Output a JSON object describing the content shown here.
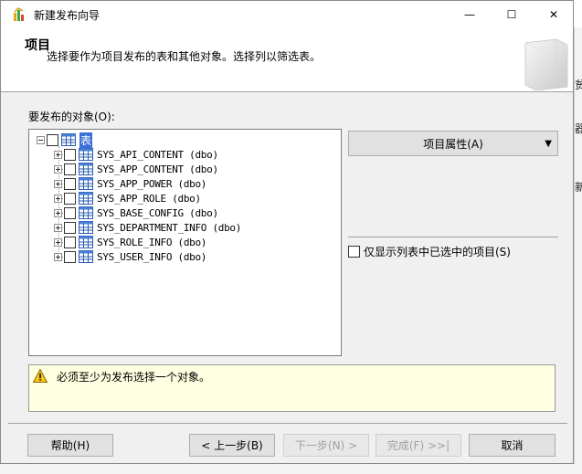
{
  "window": {
    "title": "新建发布向导",
    "minimize_glyph": "—",
    "maximize_glyph": "☐",
    "close_glyph": "✕"
  },
  "header": {
    "title": "项目",
    "subtitle": "选择要作为项目发布的表和其他对象。选择列以筛选表。"
  },
  "objects_label": "要发布的对象(O):",
  "tree": {
    "root_label": "表",
    "items": [
      "SYS_API_CONTENT (dbo)",
      "SYS_APP_CONTENT (dbo)",
      "SYS_APP_POWER (dbo)",
      "SYS_APP_ROLE (dbo)",
      "SYS_BASE_CONFIG (dbo)",
      "SYS_DEPARTMENT_INFO (dbo)",
      "SYS_ROLE_INFO (dbo)",
      "SYS_USER_INFO (dbo)"
    ]
  },
  "properties_button": "项目属性(A)",
  "filter_checkbox": "仅显示列表中已选中的项目(S)",
  "warning": "必须至少为发布选择一个对象。",
  "buttons": {
    "help": "帮助(H)",
    "back": "< 上一步(B)",
    "next": "下一步(N) >",
    "finish": "完成(F) >>|",
    "cancel": "取消"
  },
  "background_fragments": [
    "贫",
    "器",
    "新"
  ],
  "colors": {
    "selection": "#3d6fd8",
    "warning_bg": "#ffffe1",
    "dialog_bg": "#f0f0f0"
  }
}
